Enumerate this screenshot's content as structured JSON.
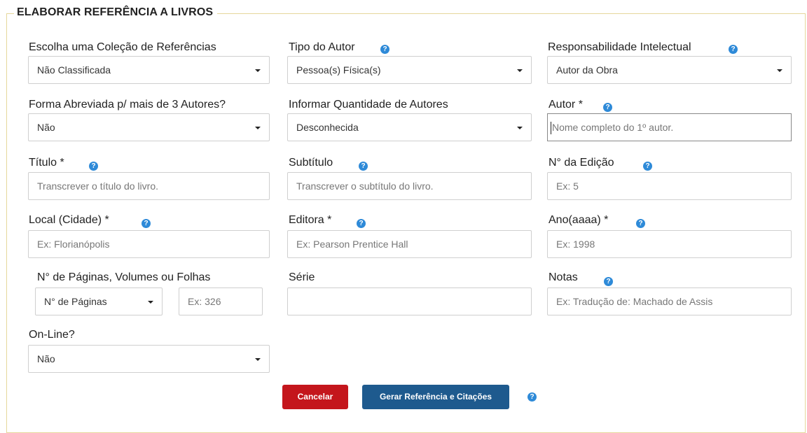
{
  "section": {
    "title": "ELABORAR REFERÊNCIA A LIVROS"
  },
  "fields": {
    "colecao": {
      "label": "Escolha uma Coleção de Referências",
      "value": "Não Classificada"
    },
    "tipo_autor": {
      "label": "Tipo do Autor",
      "value": "Pessoa(s) Física(s)"
    },
    "responsabilidade": {
      "label": "Responsabilidade Intelectual",
      "value": "Autor da Obra"
    },
    "forma_abreviada": {
      "label": "Forma Abreviada p/ mais de 3 Autores?",
      "value": "Não"
    },
    "quantidade_autores": {
      "label": "Informar Quantidade de Autores",
      "value": "Desconhecida"
    },
    "autor": {
      "label": "Autor *",
      "placeholder": "Nome completo do 1º autor."
    },
    "titulo": {
      "label": "Título *",
      "placeholder": "Transcrever o título do livro."
    },
    "subtitulo": {
      "label": "Subtítulo",
      "placeholder": "Transcrever o subtítulo do livro."
    },
    "edicao": {
      "label": "N° da Edição",
      "placeholder": "Ex: 5"
    },
    "local": {
      "label": "Local (Cidade) *",
      "placeholder": "Ex: Florianópolis"
    },
    "editora": {
      "label": "Editora *",
      "placeholder": "Ex: Pearson Prentice Hall"
    },
    "ano": {
      "label": "Ano(aaaa) *",
      "placeholder": "Ex: 1998"
    },
    "paginas": {
      "label": "N° de Páginas, Volumes ou Folhas",
      "type_value": "N° de Páginas",
      "placeholder": "Ex: 326"
    },
    "serie": {
      "label": "Série",
      "placeholder": ""
    },
    "notas": {
      "label": "Notas",
      "placeholder": "Ex: Tradução de: Machado de Assis"
    },
    "online": {
      "label": "On-Line?",
      "value": "Não"
    }
  },
  "buttons": {
    "cancel": "Cancelar",
    "generate": "Gerar Referência e Citações"
  },
  "colors": {
    "help_icon": "#2e8ad8",
    "cancel": "#c4161c",
    "generate": "#1e5a8e",
    "frame_border": "#e6d79b"
  }
}
